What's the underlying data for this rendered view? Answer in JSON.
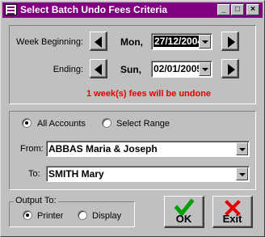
{
  "window": {
    "title": "Select Batch Undo Fees Criteria",
    "controls": {
      "minimize": "_",
      "maximize": "□",
      "close": "×"
    }
  },
  "dates": {
    "beginning_label": "Week Beginning:",
    "beginning_day": "Mon,",
    "beginning_value": "27/12/2004",
    "ending_label": "Ending:",
    "ending_day": "Sun,",
    "ending_value": "02/01/2005"
  },
  "message": "1 week(s) fees will be undone",
  "accounts": {
    "all_label": "All Accounts",
    "range_label": "Select Range",
    "selected": "all",
    "from_label": "From:",
    "from_value": "ABBAS Maria & Joseph",
    "to_label": "To:",
    "to_value": "SMITH Mary"
  },
  "output": {
    "legend": "Output To:",
    "printer_label": "Printer",
    "display_label": "Display",
    "selected": "printer"
  },
  "buttons": {
    "ok_label": "OK",
    "exit_label": "Exit"
  },
  "colors": {
    "titlebar": "#800080",
    "message": "#e00000",
    "ok_check": "#00a000",
    "exit_x": "#e00000",
    "face": "#c0c0c0"
  },
  "icons": {
    "prev": "left-arrow-icon",
    "next": "right-arrow-icon",
    "dropdown": "chevron-down-icon",
    "ok": "checkmark-icon",
    "exit": "x-icon"
  }
}
